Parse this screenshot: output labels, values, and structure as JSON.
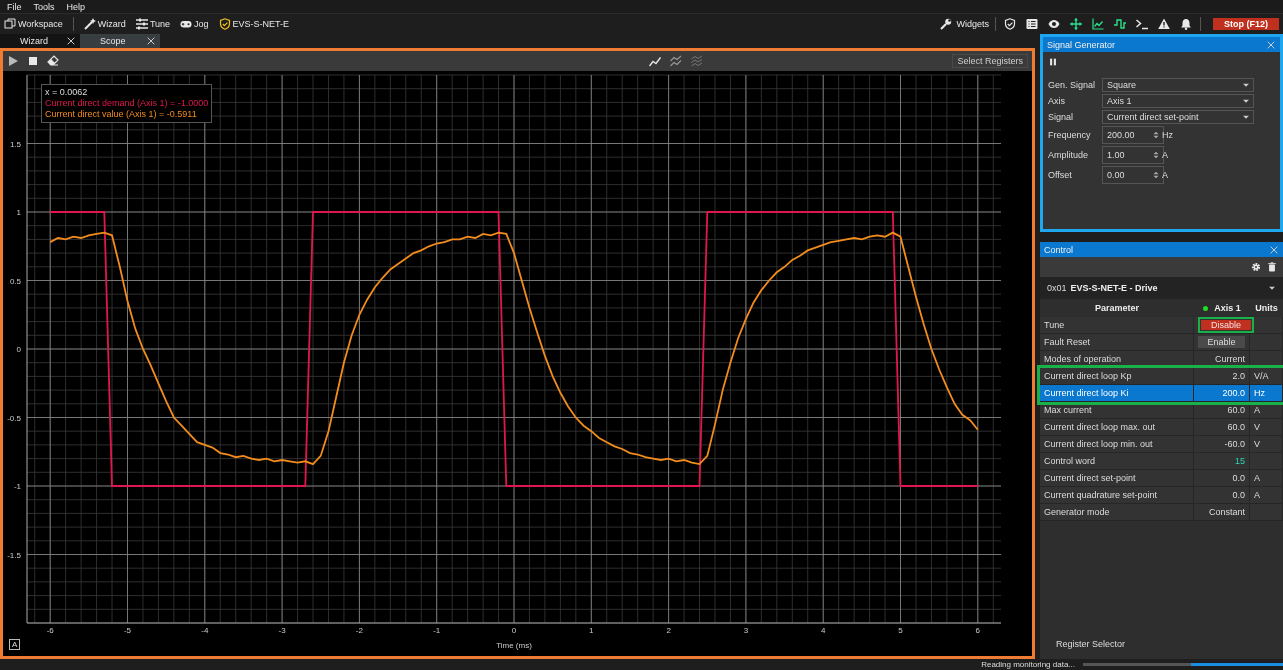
{
  "menu": [
    "File",
    "Tools",
    "Help"
  ],
  "toolbar": {
    "left": [
      {
        "kind": "windows",
        "label": "Workspace"
      },
      {
        "kind": "wand",
        "label": "Wizard"
      },
      {
        "kind": "sliders",
        "label": "Tune"
      },
      {
        "kind": "gamepad",
        "label": "Jog"
      },
      {
        "kind": "shield",
        "label": "EVS-S-NET-E"
      }
    ],
    "widgets": "Widgets",
    "icons": [
      {
        "kind": "shield-check"
      },
      {
        "kind": "list"
      },
      {
        "kind": "eye"
      },
      {
        "kind": "move"
      },
      {
        "kind": "chart"
      },
      {
        "kind": "wave"
      },
      {
        "kind": "terminal"
      },
      {
        "kind": "warning"
      },
      {
        "kind": "bell"
      }
    ],
    "stop": "Stop (F12)"
  },
  "tabs": [
    {
      "label": "Wizard",
      "selected": false
    },
    {
      "label": "Scope",
      "selected": true
    }
  ],
  "scope": {
    "highlighted": true,
    "select_registers": "Select Registers",
    "autoscale": "A",
    "tooltip": {
      "x": "x = 0.0062",
      "lines": [
        "Current direct demand (Axis 1) = -1.0000",
        "Current direct value (Axis 1) = -0.5911"
      ]
    },
    "chart_data": {
      "type": "line",
      "grid": true,
      "xlabel": "Time (ms)",
      "xlim": [
        -6.3,
        6.3
      ],
      "ylim": [
        -2,
        2
      ],
      "xticks": [
        -6,
        -5,
        -4,
        -3,
        -2,
        -1,
        0,
        1,
        2,
        3,
        4,
        5,
        6
      ],
      "yticks": [
        -1.5,
        -1,
        -0.5,
        0,
        0.5,
        1,
        1.5
      ],
      "x": [
        -6.0,
        -5.9,
        -5.8,
        -5.7,
        -5.6,
        -5.5,
        -5.4,
        -5.3,
        -5.2,
        -5.1,
        -5.0,
        -4.9,
        -4.8,
        -4.7,
        -4.6,
        -4.5,
        -4.4,
        -4.3,
        -4.2,
        -4.1,
        -4.0,
        -3.9,
        -3.8,
        -3.7,
        -3.6,
        -3.5,
        -3.4,
        -3.3,
        -3.2,
        -3.1,
        -3.0,
        -2.9,
        -2.8,
        -2.7,
        -2.6,
        -2.5,
        -2.4,
        -2.3,
        -2.2,
        -2.1,
        -2.0,
        -1.9,
        -1.8,
        -1.7,
        -1.6,
        -1.5,
        -1.4,
        -1.3,
        -1.2,
        -1.1,
        -1.0,
        -0.9,
        -0.8,
        -0.7,
        -0.6,
        -0.5,
        -0.4,
        -0.3,
        -0.2,
        -0.1,
        0.0,
        0.1,
        0.2,
        0.3,
        0.4,
        0.5,
        0.6,
        0.7,
        0.8,
        0.9,
        1.0,
        1.1,
        1.2,
        1.3,
        1.4,
        1.5,
        1.6,
        1.7,
        1.8,
        1.9,
        2.0,
        2.1,
        2.2,
        2.3,
        2.4,
        2.5,
        2.6,
        2.7,
        2.8,
        2.9,
        3.0,
        3.1,
        3.2,
        3.3,
        3.4,
        3.5,
        3.6,
        3.7,
        3.8,
        3.9,
        4.0,
        4.1,
        4.2,
        4.3,
        4.4,
        4.5,
        4.6,
        4.7,
        4.8,
        4.9,
        5.0,
        5.1,
        5.2,
        5.3,
        5.4,
        5.5,
        5.6,
        5.7,
        5.8,
        5.9,
        6.0
      ],
      "series": [
        {
          "color": "#e0174f",
          "values": [
            1,
            1,
            1,
            1,
            1,
            1,
            1,
            1,
            -1,
            -1,
            -1,
            -1,
            -1,
            -1,
            -1,
            -1,
            -1,
            -1,
            -1,
            -1,
            -1,
            -1,
            -1,
            -1,
            -1,
            -1,
            -1,
            -1,
            -1,
            -1,
            -1,
            -1,
            -1,
            -1,
            1,
            1,
            1,
            1,
            1,
            1,
            1,
            1,
            1,
            1,
            1,
            1,
            1,
            1,
            1,
            1,
            1,
            1,
            1,
            1,
            1,
            1,
            1,
            1,
            1,
            -1,
            -1,
            -1,
            -1,
            -1,
            -1,
            -1,
            -1,
            -1,
            -1,
            -1,
            -1,
            -1,
            -1,
            -1,
            -1,
            -1,
            -1,
            -1,
            -1,
            -1,
            -1,
            -1,
            -1,
            -1,
            -1,
            1,
            1,
            1,
            1,
            1,
            1,
            1,
            1,
            1,
            1,
            1,
            1,
            1,
            1,
            1,
            1,
            1,
            1,
            1,
            1,
            1,
            1,
            1,
            1,
            1,
            -1,
            -1,
            -1,
            -1,
            -1,
            -1,
            -1,
            -1,
            -1,
            -1,
            -1
          ]
        },
        {
          "color": "#f28c1c",
          "values": [
            0.78,
            0.81,
            0.8,
            0.82,
            0.81,
            0.83,
            0.84,
            0.85,
            0.83,
            0.6,
            0.35,
            0.15,
            0.0,
            -0.12,
            -0.25,
            -0.38,
            -0.5,
            -0.56,
            -0.62,
            -0.68,
            -0.7,
            -0.72,
            -0.76,
            -0.77,
            -0.79,
            -0.78,
            -0.8,
            -0.81,
            -0.8,
            -0.82,
            -0.81,
            -0.82,
            -0.83,
            -0.82,
            -0.84,
            -0.78,
            -0.6,
            -0.35,
            -0.1,
            0.1,
            0.25,
            0.36,
            0.45,
            0.52,
            0.58,
            0.62,
            0.66,
            0.7,
            0.72,
            0.75,
            0.77,
            0.78,
            0.8,
            0.8,
            0.82,
            0.81,
            0.84,
            0.83,
            0.85,
            0.84,
            0.7,
            0.5,
            0.3,
            0.12,
            -0.05,
            -0.2,
            -0.32,
            -0.42,
            -0.5,
            -0.56,
            -0.6,
            -0.65,
            -0.68,
            -0.71,
            -0.73,
            -0.76,
            -0.77,
            -0.79,
            -0.8,
            -0.81,
            -0.8,
            -0.82,
            -0.81,
            -0.83,
            -0.84,
            -0.78,
            -0.55,
            -0.3,
            -0.1,
            0.08,
            0.22,
            0.34,
            0.43,
            0.5,
            0.56,
            0.6,
            0.65,
            0.68,
            0.72,
            0.74,
            0.76,
            0.78,
            0.79,
            0.8,
            0.81,
            0.8,
            0.82,
            0.83,
            0.82,
            0.85,
            0.82,
            0.6,
            0.38,
            0.18,
            0.0,
            -0.15,
            -0.28,
            -0.4,
            -0.48,
            -0.52,
            -0.59
          ]
        }
      ]
    }
  },
  "signal_generator": {
    "title": "Signal Generator",
    "highlighted": true,
    "fields": [
      {
        "kind": "select",
        "label": "Gen. Signal",
        "value": "Square"
      },
      {
        "kind": "select",
        "label": "Axis",
        "value": "Axis 1"
      },
      {
        "kind": "select",
        "label": "Signal",
        "value": "Current direct set-point"
      },
      {
        "kind": "spin",
        "label": "Frequency",
        "value": "200.00",
        "unit": "Hz"
      },
      {
        "kind": "spin",
        "label": "Amplitude",
        "value": "1.00",
        "unit": "A"
      },
      {
        "kind": "spin",
        "label": "Offset",
        "value": "0.00",
        "unit": "A"
      }
    ]
  },
  "control": {
    "title": "Control",
    "device": {
      "address": "0x01",
      "name": "EVS-S-NET-E - Drive"
    },
    "columns": [
      "Parameter",
      "Axis 1",
      "Units"
    ],
    "axis_online": true,
    "rows": [
      {
        "kind": "button",
        "name": "Tune",
        "value": "Disable",
        "on": true,
        "selected": false,
        "highlighted": true
      },
      {
        "kind": "button",
        "name": "Fault Reset",
        "value": "Enable",
        "on": false,
        "selected": false,
        "highlighted": false
      },
      {
        "kind": "value",
        "name": "Modes of operation",
        "value": "Current",
        "selected": false,
        "highlighted": false
      },
      {
        "kind": "value",
        "name": "Current direct loop Kp",
        "value": "2.0",
        "unit": "V/A",
        "selected": false,
        "highlighted": true
      },
      {
        "kind": "value",
        "name": "Current direct loop Ki",
        "value": "200.0",
        "unit": "Hz",
        "selected": true,
        "highlighted": true
      },
      {
        "kind": "value",
        "name": "Max current",
        "value": "60.0",
        "unit": "A",
        "selected": false,
        "highlighted": false
      },
      {
        "kind": "value",
        "name": "Current direct loop max. out",
        "value": "60.0",
        "unit": "V",
        "selected": false,
        "highlighted": false
      },
      {
        "kind": "value",
        "name": "Current direct loop min. out",
        "value": "-60.0",
        "unit": "V",
        "selected": false,
        "highlighted": false
      },
      {
        "kind": "live",
        "name": "Control word",
        "value": "15",
        "selected": false,
        "highlighted": false
      },
      {
        "kind": "value",
        "name": "Current direct set-point",
        "value": "0.0",
        "unit": "A",
        "selected": false,
        "highlighted": false
      },
      {
        "kind": "value",
        "name": "Current quadrature set-point",
        "value": "0.0",
        "unit": "A",
        "selected": false,
        "highlighted": false
      },
      {
        "kind": "value",
        "name": "Generator mode",
        "value": "Constant",
        "selected": false,
        "highlighted": false
      }
    ],
    "footer": "Register Selector"
  },
  "status": {
    "text": "Reading monitoring data...",
    "level": 0.46
  }
}
